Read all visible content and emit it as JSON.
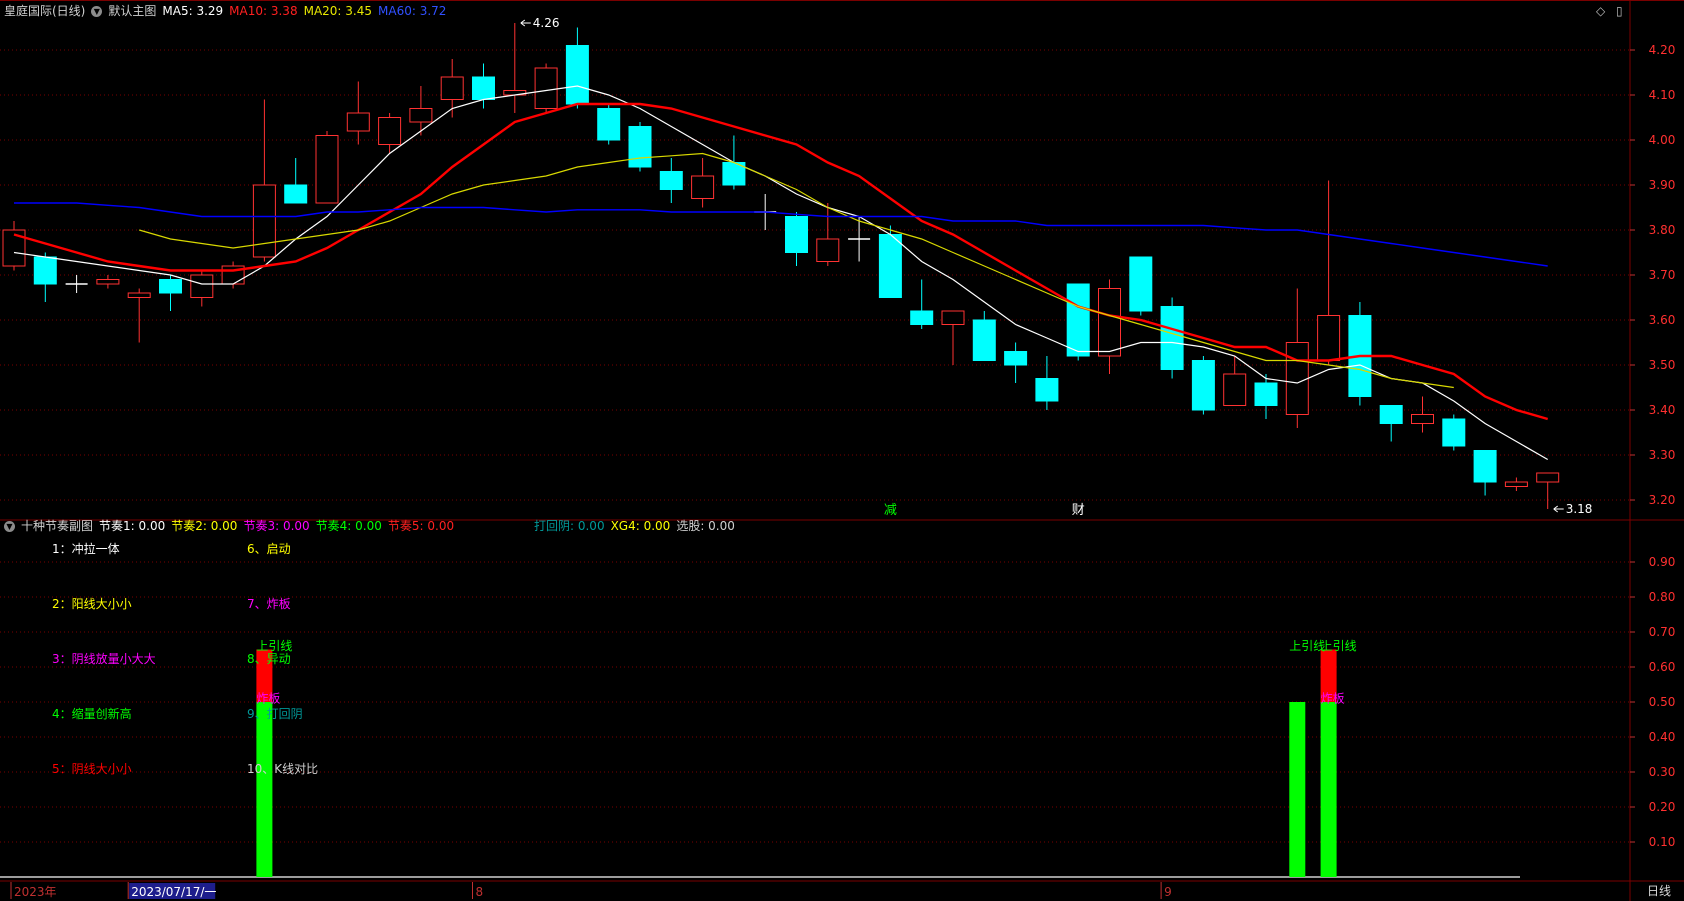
{
  "main_header": {
    "stock": "皇庭国际(日线)",
    "template": "默认主图",
    "ma5": "MA5: 3.29",
    "ma10": "MA10: 3.38",
    "ma20": "MA20: 3.45",
    "ma60": "MA60: 3.72"
  },
  "sub_header": {
    "title": "十种节奏副图",
    "r1": "节奏1: 0.00",
    "r2": "节奏2: 0.00",
    "r3": "节奏3: 0.00",
    "r4": "节奏4: 0.00",
    "r5": "节奏5: 0.00",
    "dhy": "打回阴: 0.00",
    "xg4": "XG4: 0.00",
    "xg": "选股: 0.00"
  },
  "controls": {
    "diamond": "◇",
    "window": "▯"
  },
  "timeframe": "日线",
  "colors": {
    "bg": "#000000",
    "grid": "#7a0000",
    "up": "#ff3232",
    "down": "#00ffff",
    "ma5": "#ffffff",
    "ma10": "#ff0000",
    "ma20": "#d8d800",
    "ma60": "#0000ff",
    "green": "#00ff00",
    "magenta": "#ff00ff",
    "yellow": "#ffff00",
    "teal": "#009999"
  },
  "chart_data": [
    {
      "type": "candlestick",
      "y_ticks": [
        "4.20",
        "4.10",
        "4.00",
        "3.90",
        "3.80",
        "3.70",
        "3.60",
        "3.50",
        "3.40",
        "3.30",
        "3.20"
      ],
      "ylim": [
        3.162,
        4.28
      ],
      "candles": [
        {
          "o": 3.72,
          "h": 3.82,
          "l": 3.71,
          "c": 3.8
        },
        {
          "o": 3.74,
          "h": 3.75,
          "l": 3.64,
          "c": 3.68
        },
        {
          "o": 3.68,
          "h": 3.7,
          "l": 3.66,
          "c": 3.68
        },
        {
          "o": 3.68,
          "h": 3.7,
          "l": 3.67,
          "c": 3.69
        },
        {
          "o": 3.65,
          "h": 3.67,
          "l": 3.55,
          "c": 3.66
        },
        {
          "o": 3.69,
          "h": 3.7,
          "l": 3.62,
          "c": 3.66
        },
        {
          "o": 3.65,
          "h": 3.71,
          "l": 3.63,
          "c": 3.7
        },
        {
          "o": 3.68,
          "h": 3.73,
          "l": 3.67,
          "c": 3.72
        },
        {
          "o": 3.74,
          "h": 4.09,
          "l": 3.73,
          "c": 3.9
        },
        {
          "o": 3.9,
          "h": 3.96,
          "l": 3.86,
          "c": 3.86
        },
        {
          "o": 3.86,
          "h": 4.02,
          "l": 3.86,
          "c": 4.01
        },
        {
          "o": 4.02,
          "h": 4.13,
          "l": 3.99,
          "c": 4.06
        },
        {
          "o": 3.99,
          "h": 4.06,
          "l": 3.97,
          "c": 4.05
        },
        {
          "o": 4.04,
          "h": 4.12,
          "l": 4.01,
          "c": 4.07
        },
        {
          "o": 4.09,
          "h": 4.18,
          "l": 4.05,
          "c": 4.14
        },
        {
          "o": 4.14,
          "h": 4.17,
          "l": 4.07,
          "c": 4.09
        },
        {
          "o": 4.1,
          "h": 4.26,
          "l": 4.06,
          "c": 4.11
        },
        {
          "o": 4.07,
          "h": 4.17,
          "l": 4.06,
          "c": 4.16
        },
        {
          "o": 4.21,
          "h": 4.25,
          "l": 4.07,
          "c": 4.08
        },
        {
          "o": 4.07,
          "h": 4.08,
          "l": 3.99,
          "c": 4.0
        },
        {
          "o": 4.03,
          "h": 4.04,
          "l": 3.93,
          "c": 3.94
        },
        {
          "o": 3.93,
          "h": 3.96,
          "l": 3.86,
          "c": 3.89
        },
        {
          "o": 3.87,
          "h": 3.96,
          "l": 3.85,
          "c": 3.92
        },
        {
          "o": 3.95,
          "h": 4.01,
          "l": 3.89,
          "c": 3.9
        },
        {
          "o": 3.84,
          "h": 3.88,
          "l": 3.8,
          "c": 3.84
        },
        {
          "o": 3.83,
          "h": 3.84,
          "l": 3.72,
          "c": 3.75
        },
        {
          "o": 3.73,
          "h": 3.86,
          "l": 3.72,
          "c": 3.78
        },
        {
          "o": 3.78,
          "h": 3.83,
          "l": 3.73,
          "c": 3.78
        },
        {
          "o": 3.79,
          "h": 3.81,
          "l": 3.65,
          "c": 3.65
        },
        {
          "o": 3.62,
          "h": 3.69,
          "l": 3.58,
          "c": 3.59
        },
        {
          "o": 3.59,
          "h": 3.62,
          "l": 3.5,
          "c": 3.62
        },
        {
          "o": 3.6,
          "h": 3.62,
          "l": 3.51,
          "c": 3.51
        },
        {
          "o": 3.53,
          "h": 3.55,
          "l": 3.46,
          "c": 3.5
        },
        {
          "o": 3.47,
          "h": 3.52,
          "l": 3.4,
          "c": 3.42
        },
        {
          "o": 3.68,
          "h": 3.68,
          "l": 3.51,
          "c": 3.52
        },
        {
          "o": 3.52,
          "h": 3.69,
          "l": 3.48,
          "c": 3.67
        },
        {
          "o": 3.74,
          "h": 3.74,
          "l": 3.61,
          "c": 3.62
        },
        {
          "o": 3.63,
          "h": 3.65,
          "l": 3.47,
          "c": 3.49
        },
        {
          "o": 3.51,
          "h": 3.52,
          "l": 3.39,
          "c": 3.4
        },
        {
          "o": 3.41,
          "h": 3.52,
          "l": 3.41,
          "c": 3.48
        },
        {
          "o": 3.46,
          "h": 3.48,
          "l": 3.38,
          "c": 3.41
        },
        {
          "o": 3.39,
          "h": 3.67,
          "l": 3.36,
          "c": 3.55
        },
        {
          "o": 3.51,
          "h": 3.91,
          "l": 3.5,
          "c": 3.61
        },
        {
          "o": 3.61,
          "h": 3.64,
          "l": 3.41,
          "c": 3.43
        },
        {
          "o": 3.41,
          "h": 3.41,
          "l": 3.33,
          "c": 3.37
        },
        {
          "o": 3.37,
          "h": 3.43,
          "l": 3.35,
          "c": 3.39
        },
        {
          "o": 3.38,
          "h": 3.39,
          "l": 3.31,
          "c": 3.32
        },
        {
          "o": 3.31,
          "h": 3.31,
          "l": 3.21,
          "c": 3.24
        },
        {
          "o": 3.23,
          "h": 3.25,
          "l": 3.22,
          "c": 3.24
        },
        {
          "o": 3.24,
          "h": 3.26,
          "l": 3.18,
          "c": 3.26
        }
      ],
      "series": [
        {
          "name": "MA5",
          "values": [
            3.75,
            3.74,
            3.73,
            3.72,
            3.71,
            3.7,
            3.68,
            3.68,
            3.72,
            3.78,
            3.83,
            3.9,
            3.97,
            4.02,
            4.07,
            4.09,
            4.1,
            4.11,
            4.12,
            4.1,
            4.07,
            4.03,
            3.99,
            3.95,
            3.92,
            3.88,
            3.85,
            3.83,
            3.79,
            3.73,
            3.69,
            3.64,
            3.59,
            3.56,
            3.53,
            3.53,
            3.55,
            3.55,
            3.54,
            3.52,
            3.47,
            3.46,
            3.49,
            3.5,
            3.47,
            3.46,
            3.42,
            3.37,
            3.33,
            3.29
          ]
        },
        {
          "name": "MA10",
          "values": [
            3.79,
            3.77,
            3.75,
            3.73,
            3.72,
            3.71,
            3.71,
            3.71,
            3.72,
            3.73,
            3.76,
            3.8,
            3.84,
            3.88,
            3.94,
            3.99,
            4.04,
            4.06,
            4.08,
            4.08,
            4.08,
            4.07,
            4.05,
            4.03,
            4.01,
            3.99,
            3.95,
            3.92,
            3.87,
            3.82,
            3.79,
            3.75,
            3.71,
            3.67,
            3.63,
            3.61,
            3.6,
            3.58,
            3.56,
            3.54,
            3.54,
            3.51,
            3.51,
            3.52,
            3.52,
            3.5,
            3.48,
            3.43,
            3.4,
            3.38
          ]
        },
        {
          "name": "MA20",
          "values": [
            null,
            null,
            null,
            null,
            3.8,
            3.78,
            3.77,
            3.76,
            3.77,
            3.78,
            3.79,
            3.8,
            3.82,
            3.85,
            3.88,
            3.9,
            3.91,
            3.92,
            3.94,
            3.95,
            3.96,
            3.965,
            3.97,
            3.95,
            3.92,
            3.89,
            3.85,
            3.82,
            3.8,
            3.78,
            3.75,
            3.72,
            3.69,
            3.66,
            3.63,
            3.61,
            3.59,
            3.57,
            3.55,
            3.53,
            3.51,
            3.51,
            3.5,
            3.49,
            3.47,
            3.46,
            3.45
          ]
        },
        {
          "name": "MA60",
          "values": [
            3.86,
            3.86,
            3.86,
            3.855,
            3.85,
            3.84,
            3.83,
            3.83,
            3.83,
            3.83,
            3.84,
            3.84,
            3.845,
            3.85,
            3.85,
            3.85,
            3.845,
            3.84,
            3.845,
            3.845,
            3.845,
            3.84,
            3.84,
            3.84,
            3.84,
            3.835,
            3.83,
            3.83,
            3.83,
            3.83,
            3.82,
            3.82,
            3.82,
            3.81,
            3.81,
            3.81,
            3.81,
            3.81,
            3.81,
            3.805,
            3.8,
            3.8,
            3.79,
            3.78,
            3.77,
            3.76,
            3.75,
            3.74,
            3.73,
            3.72
          ]
        }
      ],
      "annotations": [
        {
          "text": "4.26",
          "index": 16,
          "price": 4.26
        },
        {
          "text": "3.18",
          "index": 49,
          "price": 3.18
        }
      ],
      "markers": [
        {
          "text": "减",
          "index": 28,
          "color": "#00ff00"
        },
        {
          "text": "财",
          "index": 34,
          "color": "#ffffff"
        }
      ]
    },
    {
      "type": "bar",
      "y_ticks": [
        "0.90",
        "0.80",
        "0.70",
        "0.60",
        "0.50",
        "0.40",
        "0.30",
        "0.20",
        "0.10"
      ],
      "ylim": [
        0,
        1.0
      ],
      "bars": [
        {
          "index": 8,
          "green": 0.5,
          "red_top": 0.65
        },
        {
          "index": 41,
          "green": 0.5
        },
        {
          "index": 42,
          "green": 0.5,
          "red_top": 0.65
        }
      ],
      "legend": [
        {
          "text": "1：冲拉一体",
          "color": "#ffffff"
        },
        {
          "text": "2：阳线大小小",
          "color": "#ffff00"
        },
        {
          "text": "3：阴线放量小大大",
          "color": "#ff00ff"
        },
        {
          "text": "4：缩量创新高",
          "color": "#00ff00"
        },
        {
          "text": "5：阴线大小小",
          "color": "#ff0000"
        },
        {
          "text": "6、启动",
          "color": "#ffff00"
        },
        {
          "text": "7、炸板",
          "color": "#ff00ff"
        },
        {
          "text": "8、异动",
          "color": "#00ff00"
        },
        {
          "text": "9、打回阴",
          "color": "#009999"
        },
        {
          "text": "10、K线对比",
          "color": "#d0d0d0"
        }
      ],
      "bar_labels": [
        {
          "text": "上引线",
          "index": 8,
          "value": 0.66,
          "color": "#00ff00"
        },
        {
          "text": "炸板",
          "index": 8,
          "value": 0.51,
          "color": "#ff00ff"
        },
        {
          "text": "上引线",
          "index": 41,
          "value": 0.66,
          "color": "#00ff00"
        },
        {
          "text": "上引线",
          "index": 42,
          "value": 0.66,
          "color": "#00ff00"
        },
        {
          "text": "炸板",
          "index": 42,
          "value": 0.51,
          "color": "#ff00ff"
        }
      ]
    }
  ],
  "x_axis": {
    "labels": [
      {
        "text": "2023年",
        "index": 0,
        "color": "#c03030"
      },
      {
        "text": "2023/07/17/一",
        "index": 4,
        "color": "#ffffff",
        "highlight": true
      },
      {
        "text": "8",
        "index": 15,
        "color": "#c03030"
      },
      {
        "text": "9",
        "index": 37,
        "color": "#c03030"
      }
    ]
  }
}
